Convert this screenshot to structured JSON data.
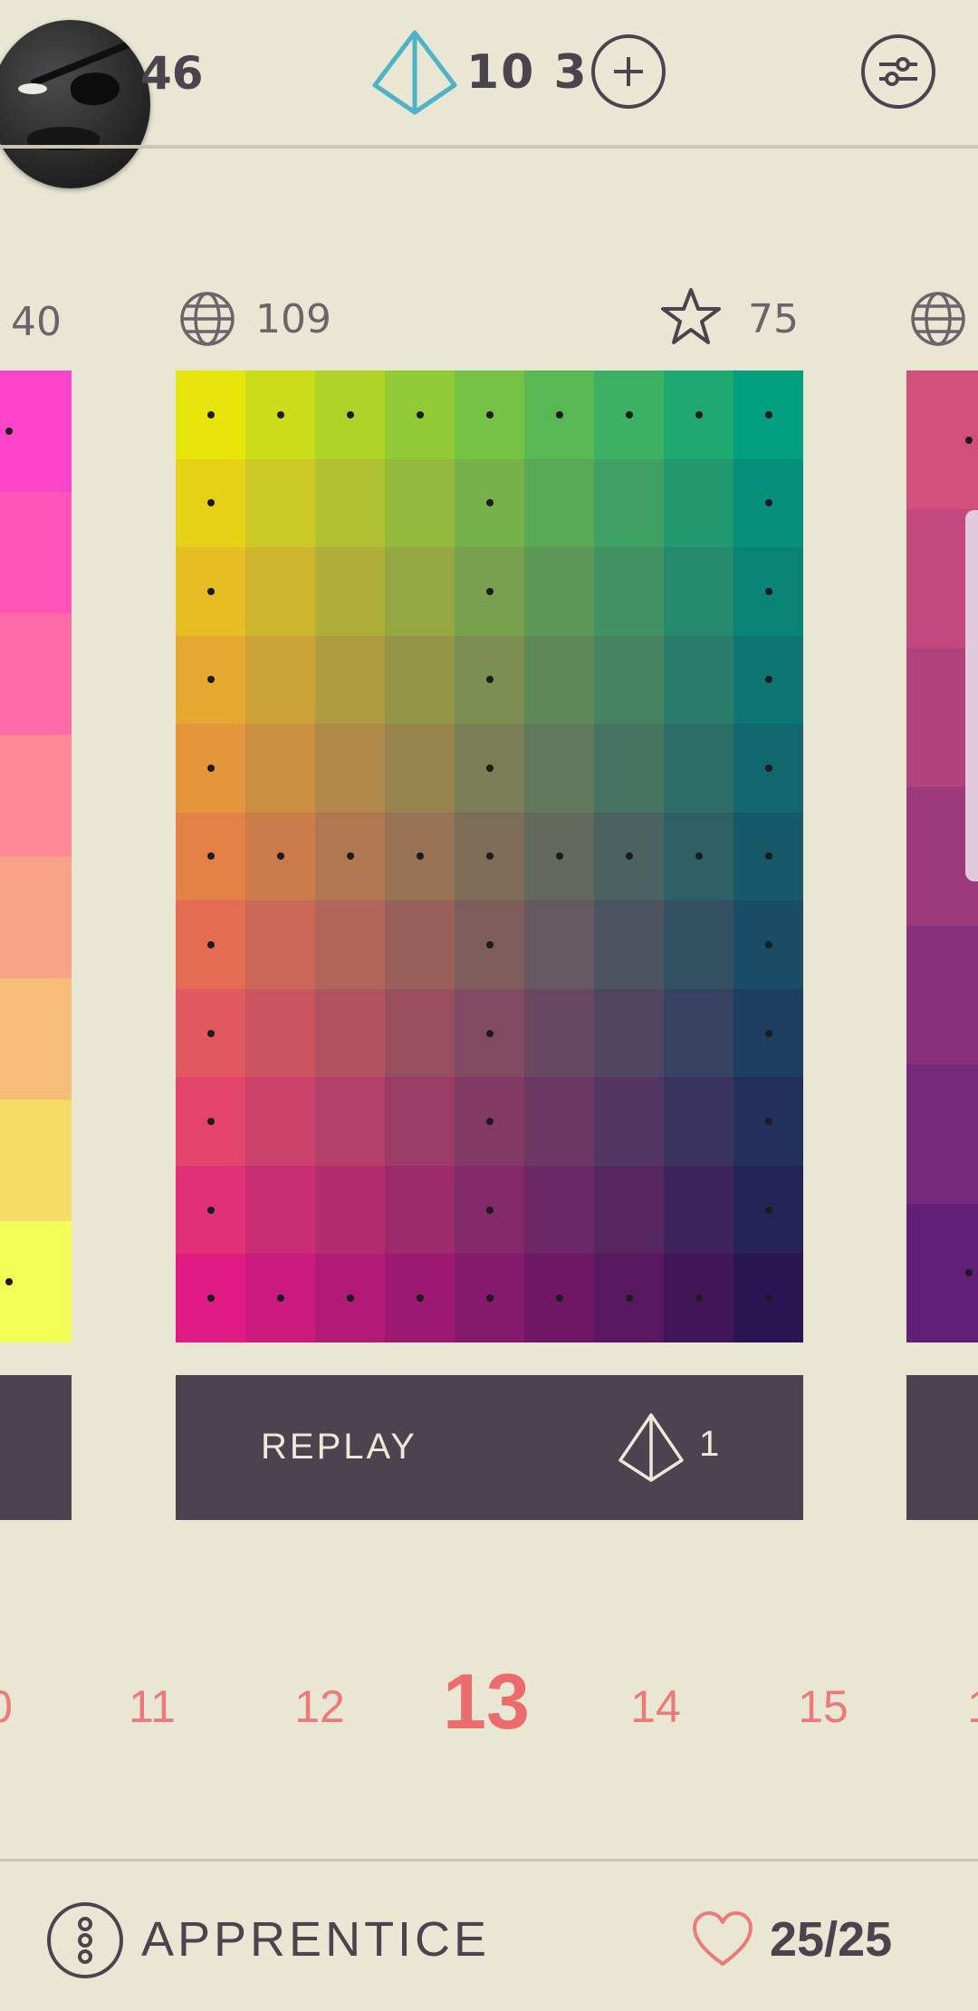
{
  "topbar": {
    "coins": "46",
    "gems": "10 3",
    "accent_teal": "#4fb3c8",
    "icons": {
      "avatar": "profile-avatar",
      "pyramid": "pyramid-icon",
      "add": "plus-icon",
      "settings": "sliders-icon"
    }
  },
  "puzzles": {
    "prev_header_count": "40",
    "current": {
      "players_count": "109",
      "rating": "75"
    },
    "replay_label": "REPLAY",
    "replay_cost": "1"
  },
  "levels": [
    "0",
    "11",
    "12",
    "13",
    "14",
    "15",
    "1"
  ],
  "current_level": "13",
  "footer": {
    "rank": "APPRENTICE",
    "lives": "25/25",
    "heart_color": "#ee7a78"
  },
  "grid": {
    "corner_colors": {
      "top_left": "#e8e50a",
      "top_right": "#029e80",
      "bottom_left": "#e01c84",
      "bottom_right": "#2a1553"
    },
    "columns": 9,
    "rows": 11
  }
}
